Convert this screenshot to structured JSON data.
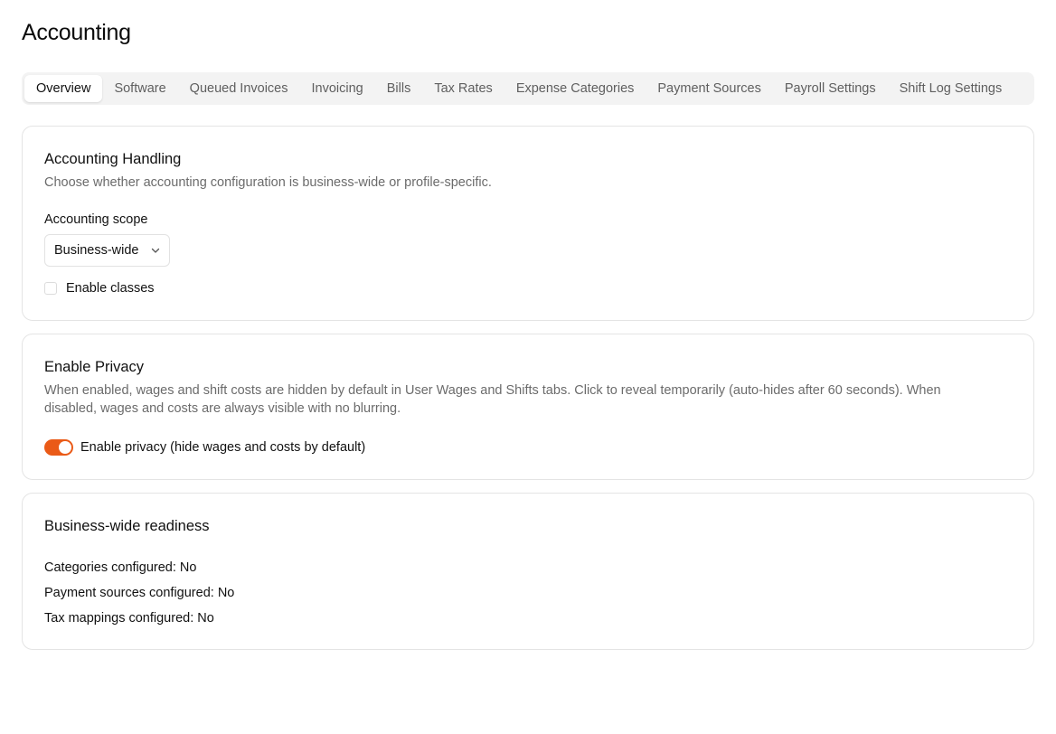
{
  "page": {
    "title": "Accounting"
  },
  "tabs": [
    {
      "label": "Overview",
      "active": true
    },
    {
      "label": "Software"
    },
    {
      "label": "Queued Invoices"
    },
    {
      "label": "Invoicing"
    },
    {
      "label": "Bills"
    },
    {
      "label": "Tax Rates"
    },
    {
      "label": "Expense Categories"
    },
    {
      "label": "Payment Sources"
    },
    {
      "label": "Payroll Settings"
    },
    {
      "label": "Shift Log Settings"
    }
  ],
  "accounting_handling": {
    "title": "Accounting Handling",
    "description": "Choose whether accounting configuration is business-wide or profile-specific.",
    "scope_label": "Accounting scope",
    "scope_value": "Business-wide",
    "enable_classes_label": "Enable classes",
    "enable_classes_checked": false
  },
  "privacy": {
    "title": "Enable Privacy",
    "description_line1": "When enabled, wages and shift costs are hidden by default in User Wages and Shifts tabs. Click to reveal temporarily (auto-hides after 60 seconds). When",
    "description_line2": "disabled, wages and costs are always visible with no blurring.",
    "toggle_label": "Enable privacy (hide wages and costs by default)",
    "toggle_on": true
  },
  "readiness": {
    "title": "Business-wide readiness",
    "items": [
      "Categories configured: No",
      "Payment sources configured: No",
      "Tax mappings configured: No"
    ]
  },
  "colors": {
    "accent": "#ea5a17",
    "tabs_background": "#f3f3f3",
    "border": "#e4e4e4",
    "muted_text": "#6b6b6b"
  },
  "icons": {
    "select_chevron": "chevron-down-icon"
  }
}
